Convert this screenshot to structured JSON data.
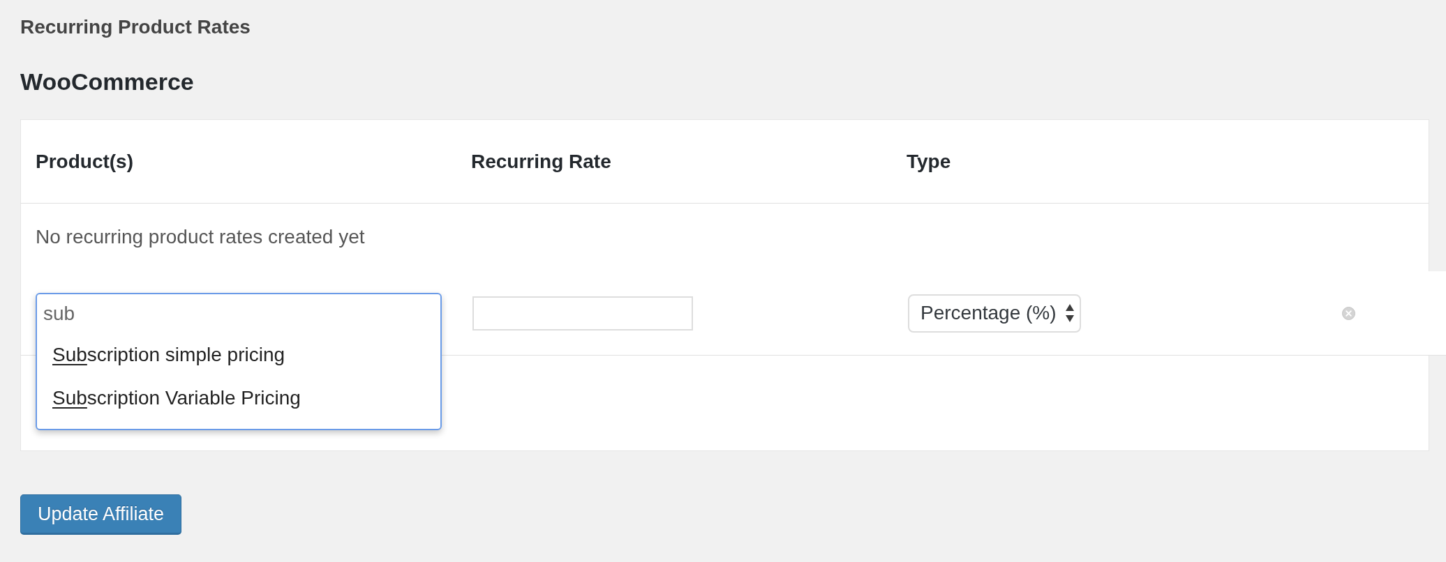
{
  "page": {
    "title": "Recurring Product Rates"
  },
  "section": {
    "title": "WooCommerce"
  },
  "table": {
    "columns": [
      "Product(s)",
      "Recurring Rate",
      "Type"
    ],
    "empty_message": "No recurring product rates created yet",
    "new_rate": {
      "products": {
        "value": "sub",
        "expanded": true,
        "results": [
          {
            "match": "Sub",
            "rest": "scription simple pricing",
            "selected": false
          },
          {
            "match": "Sub",
            "rest": "scription Variable Pricing",
            "selected": false
          }
        ]
      },
      "type": {
        "value": "Percentage (%)"
      }
    }
  },
  "submit_button": {
    "label": "Update Affiliate"
  }
}
